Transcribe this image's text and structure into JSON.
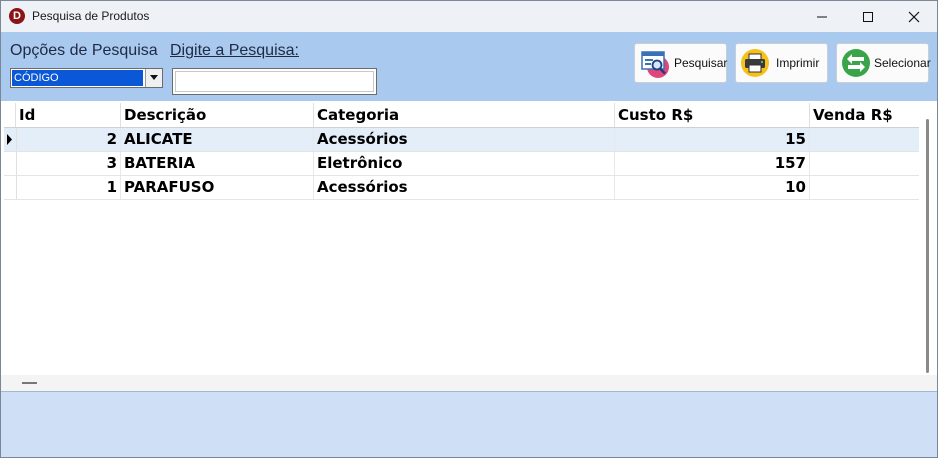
{
  "window": {
    "title": "Pesquisa de Produtos",
    "app_icon_letter": "D"
  },
  "toolbar": {
    "options_label": "Opções de Pesquisa",
    "search_label": "Digite a Pesquisa:",
    "search_option_selected": "CÓDIGO",
    "search_value": "",
    "buttons": {
      "search": "Pesquisar",
      "print": "Imprimir",
      "select": "Selecionar"
    }
  },
  "grid": {
    "columns": [
      "Id",
      "Descrição",
      "Categoria",
      "Custo R$",
      "Venda R$"
    ],
    "rows": [
      {
        "id": "2",
        "descricao": "ALICATE",
        "categoria": "Acessórios",
        "custo": "15",
        "venda": ""
      },
      {
        "id": "3",
        "descricao": "BATERIA",
        "categoria": "Eletrônico",
        "custo": "157",
        "venda": ""
      },
      {
        "id": "1",
        "descricao": "PARAFUSO",
        "categoria": "Acessórios",
        "custo": "10",
        "venda": ""
      }
    ],
    "current_row_index": 0
  },
  "colors": {
    "toolbar_bg": "#a9c9ef",
    "selection_bg": "#0a57d8",
    "current_row_bg": "#e3eef9",
    "status_bg": "#cfe0f6"
  }
}
